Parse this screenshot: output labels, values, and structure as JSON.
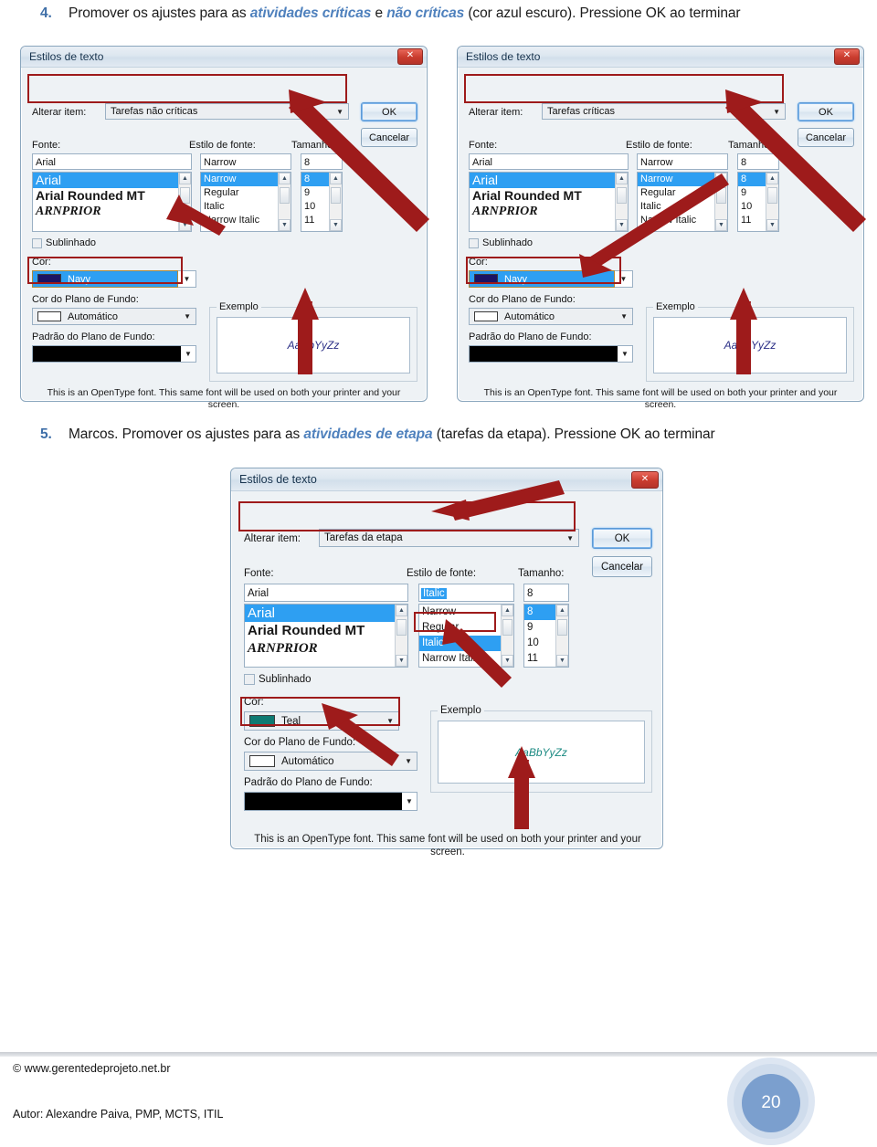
{
  "page": {
    "number": "20"
  },
  "steps": [
    {
      "num": "4.",
      "pre": "Promover os ajustes para as ",
      "em1": "atividades críticas",
      "mid": " e ",
      "em2": "não críticas",
      "post": " (cor azul escuro). Pressione OK ao terminar"
    },
    {
      "num": "5.",
      "pre": "Marcos. Promover os ajustes para as ",
      "em1": "atividades de etapa",
      "mid": "",
      "em2": "",
      "post": " (tarefas da etapa). Pressione OK ao terminar"
    }
  ],
  "dialogs": [
    {
      "title": "Estilos de texto",
      "close_label": "✕",
      "alterar_label": "Alterar item:",
      "alterar_value": "Tarefas não críticas",
      "ok_label": "OK",
      "cancel_label": "Cancelar",
      "fonte_label": "Fonte:",
      "fonte_value": "Arial",
      "fonte_items": [
        "Arial",
        "Arial Rounded MT",
        "ARNPRIOR"
      ],
      "fonte_selected_index": 0,
      "estilo_label": "Estilo de fonte:",
      "estilo_value": "Narrow",
      "estilo_items": [
        "Narrow",
        "Regular",
        "Italic",
        "Narrow Italic"
      ],
      "estilo_selected_index": 0,
      "tamanho_label": "Tamanho:",
      "tamanho_value": "8",
      "tamanho_items": [
        "8",
        "9",
        "10",
        "11"
      ],
      "tamanho_selected_index": 0,
      "sublinhado_label": "Sublinhado",
      "cor_label": "Cor:",
      "cor_value": "Navy",
      "cor_hex": "#1b1464",
      "cor_fundo_label": "Cor do Plano de Fundo:",
      "cor_fundo_value": "Automático",
      "cor_fundo_hex": "#ffffff",
      "padrao_label": "Padrão do Plano de Fundo:",
      "padrao_hex": "#000000",
      "exemplo_label": "Exemplo",
      "exemplo_text": "AaBbYyZz",
      "exemplo_hex": "#2b2f86",
      "hint": "This is an OpenType font. This same font will be used on both your printer and your screen."
    },
    {
      "title": "Estilos de texto",
      "close_label": "✕",
      "alterar_label": "Alterar item:",
      "alterar_value": "Tarefas críticas",
      "ok_label": "OK",
      "cancel_label": "Cancelar",
      "fonte_label": "Fonte:",
      "fonte_value": "Arial",
      "fonte_items": [
        "Arial",
        "Arial Rounded MT",
        "ARNPRIOR"
      ],
      "fonte_selected_index": 0,
      "estilo_label": "Estilo de fonte:",
      "estilo_value": "Narrow",
      "estilo_items": [
        "Narrow",
        "Regular",
        "Italic",
        "Narrow Italic"
      ],
      "estilo_selected_index": 0,
      "tamanho_label": "Tamanho:",
      "tamanho_value": "8",
      "tamanho_items": [
        "8",
        "9",
        "10",
        "11"
      ],
      "tamanho_selected_index": 0,
      "sublinhado_label": "Sublinhado",
      "cor_label": "Cor:",
      "cor_value": "Navy",
      "cor_hex": "#1b1464",
      "cor_fundo_label": "Cor do Plano de Fundo:",
      "cor_fundo_value": "Automático",
      "cor_fundo_hex": "#ffffff",
      "padrao_label": "Padrão do Plano de Fundo:",
      "padrao_hex": "#000000",
      "exemplo_label": "Exemplo",
      "exemplo_text": "AaBbYyZz",
      "exemplo_hex": "#2b2f86",
      "hint": "This is an OpenType font. This same font will be used on both your printer and your screen."
    },
    {
      "title": "Estilos de texto",
      "close_label": "✕",
      "alterar_label": "Alterar item:",
      "alterar_value": "Tarefas da etapa",
      "ok_label": "OK",
      "cancel_label": "Cancelar",
      "fonte_label": "Fonte:",
      "fonte_value": "Arial",
      "fonte_items": [
        "Arial",
        "Arial Rounded MT",
        "ARNPRIOR"
      ],
      "fonte_selected_index": 0,
      "estilo_label": "Estilo de fonte:",
      "estilo_value": "Italic",
      "estilo_items": [
        "Narrow",
        "Regular",
        "Italic",
        "Narrow Italic"
      ],
      "estilo_selected_index": 2,
      "tamanho_label": "Tamanho:",
      "tamanho_value": "8",
      "tamanho_items": [
        "8",
        "9",
        "10",
        "11"
      ],
      "tamanho_selected_index": 0,
      "sublinhado_label": "Sublinhado",
      "cor_label": "Cor:",
      "cor_value": "Teal",
      "cor_hex": "#0e7a72",
      "cor_fundo_label": "Cor do Plano de Fundo:",
      "cor_fundo_value": "Automático",
      "cor_fundo_hex": "#ffffff",
      "padrao_label": "Padrão do Plano de Fundo:",
      "padrao_hex": "#000000",
      "exemplo_label": "Exemplo",
      "exemplo_text": "AaBbYyZz",
      "exemplo_hex": "#1b8a82",
      "hint": "This is an OpenType font. This same font will be used on both your printer and your screen."
    }
  ],
  "footer": {
    "copyright": "© www.gerentedeprojeto.net.br",
    "author": "Autor: Alexandre Paiva, PMP, MCTS, ITIL"
  },
  "colors": {
    "annotation_red": "#9e1b1b",
    "accent_blue": "#4f81bd",
    "selection_blue": "#2e9ff2"
  }
}
